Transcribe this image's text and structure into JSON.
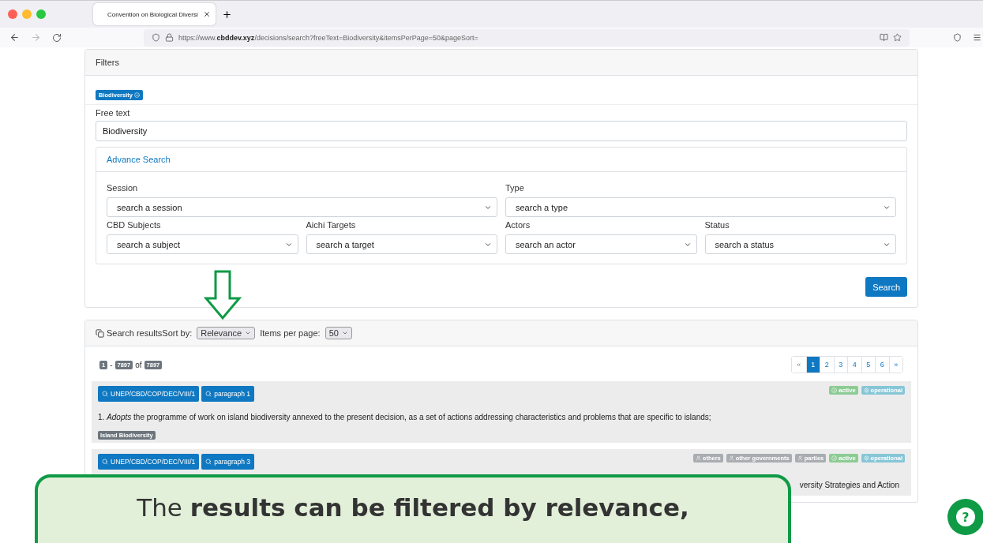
{
  "browser": {
    "tab_title": "Convention on Biological Diversi",
    "url_prefix": "https://www.",
    "url_domain": "cbddev.xyz",
    "url_path": "/decisions/search?freeText=Biodiversity&itemsPerPage=50&pageSort="
  },
  "filters": {
    "title": "Filters",
    "active_tags": [
      "Biodiversity"
    ],
    "free_text_label": "Free text",
    "free_text_value": "Biodiversity",
    "advanced": {
      "title": "Advance Search",
      "expanded": true,
      "fields": [
        {
          "label": "Session",
          "placeholder": "search a session",
          "wide": true
        },
        {
          "label": "Type",
          "placeholder": "search a type",
          "wide": true
        },
        {
          "label": "CBD Subjects",
          "placeholder": "search a subject",
          "wide": false
        },
        {
          "label": "Aichi Targets",
          "placeholder": "search a target",
          "wide": false
        },
        {
          "label": "Actors",
          "placeholder": "search an actor",
          "wide": false
        },
        {
          "label": "Status",
          "placeholder": "search a status",
          "wide": false
        }
      ]
    },
    "search_button": "Search"
  },
  "results": {
    "title": "Search results",
    "sort_label": "Sort by:",
    "sort_value": "Relevance",
    "per_page_label": "Items per page:",
    "per_page_value": "50",
    "range_start": "1",
    "range_dash": "-",
    "range_end": "7897",
    "of": "of",
    "total": "7897",
    "pages": [
      {
        "label": "«",
        "selected": false
      },
      {
        "label": "1",
        "selected": true
      },
      {
        "label": "2",
        "selected": false
      },
      {
        "label": "3",
        "selected": false
      },
      {
        "label": "4",
        "selected": false
      },
      {
        "label": "5",
        "selected": false
      },
      {
        "label": "6",
        "selected": false
      },
      {
        "label": "»",
        "selected": false
      }
    ],
    "items": [
      {
        "decision": "UNEP/CBD/COP/DEC/VIII/1",
        "paragraph": "paragraph 1",
        "badges": [
          {
            "kind": "status",
            "label": "active"
          },
          {
            "kind": "type",
            "label": "operational"
          }
        ],
        "text": "1. *Adopts* the programme of work on island biodiversity annexed to the present decision, as a set of actions addressing characteristics and problems that are specific to islands;",
        "subjects": [
          "Island Biodiversity"
        ]
      },
      {
        "decision": "UNEP/CBD/COP/DEC/VIII/1",
        "paragraph": "paragraph 3",
        "badges": [
          {
            "kind": "actor",
            "label": "others"
          },
          {
            "kind": "actor",
            "label": "other governments"
          },
          {
            "kind": "actor",
            "label": "parties"
          },
          {
            "kind": "status",
            "label": "active"
          },
          {
            "kind": "type",
            "label": "operational"
          }
        ],
        "text": "versity Strategies and Action"
      }
    ]
  },
  "callout": {
    "text": "The **results can be filtered by relevance,**"
  },
  "help_button": "?"
}
